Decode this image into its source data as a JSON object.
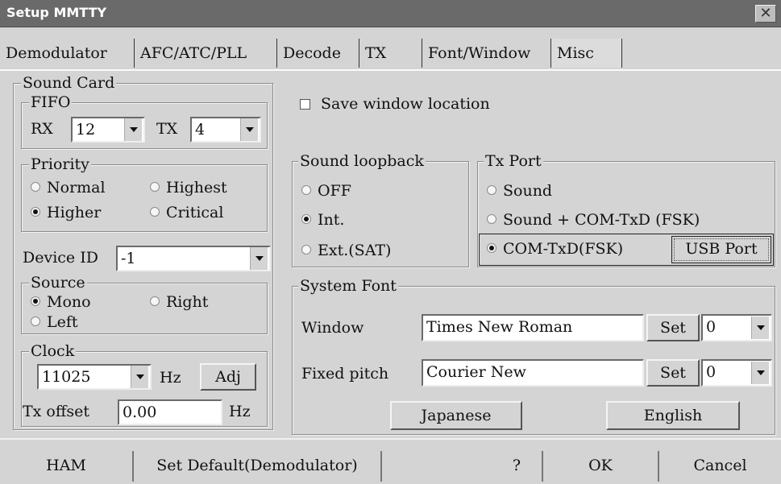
{
  "window": {
    "title": "Setup MMTTY",
    "close_glyph": "✕"
  },
  "tabs": [
    {
      "label": "Demodulator"
    },
    {
      "label": "AFC/ATC/PLL"
    },
    {
      "label": "Decode"
    },
    {
      "label": "TX"
    },
    {
      "label": "Font/Window"
    },
    {
      "label": "Misc",
      "active": true
    }
  ],
  "sound_card": {
    "legend": "Sound Card",
    "fifo": {
      "legend": "FIFO",
      "rx_label": "RX",
      "rx_value": "12",
      "tx_label": "TX",
      "tx_value": "4"
    },
    "priority": {
      "legend": "Priority",
      "options": [
        "Normal",
        "Highest",
        "Higher",
        "Critical"
      ],
      "selected": "Higher"
    },
    "device_id": {
      "label": "Device ID",
      "value": "-1"
    },
    "source": {
      "legend": "Source",
      "options": [
        "Mono",
        "Right",
        "Left"
      ],
      "selected": "Mono"
    },
    "clock": {
      "legend": "Clock",
      "value": "11025",
      "unit": "Hz",
      "adj_label": "Adj",
      "tx_offset_label": "Tx offset",
      "tx_offset_value": "0.00",
      "tx_offset_unit": "Hz"
    }
  },
  "save_window_location": {
    "label": "Save window location",
    "checked": false
  },
  "sound_loopback": {
    "legend": "Sound loopback",
    "options": [
      "OFF",
      "Int.",
      "Ext.(SAT)"
    ],
    "selected": "Int."
  },
  "tx_port": {
    "legend": "Tx Port",
    "options": [
      "Sound",
      "Sound + COM-TxD (FSK)",
      "COM-TxD(FSK)"
    ],
    "selected": "COM-TxD(FSK)",
    "usb_port_label": "USB Port"
  },
  "system_font": {
    "legend": "System Font",
    "window": {
      "label": "Window",
      "font": "Times New Roman",
      "set_label": "Set",
      "size": "0"
    },
    "fixed_pitch": {
      "label": "Fixed pitch",
      "font": "Courier New",
      "set_label": "Set",
      "size": "0"
    },
    "japanese_label": "Japanese",
    "english_label": "English"
  },
  "bottom": {
    "ham": "HAM",
    "set_default": "Set Default(Demodulator)",
    "help": "?",
    "ok": "OK",
    "cancel": "Cancel"
  }
}
